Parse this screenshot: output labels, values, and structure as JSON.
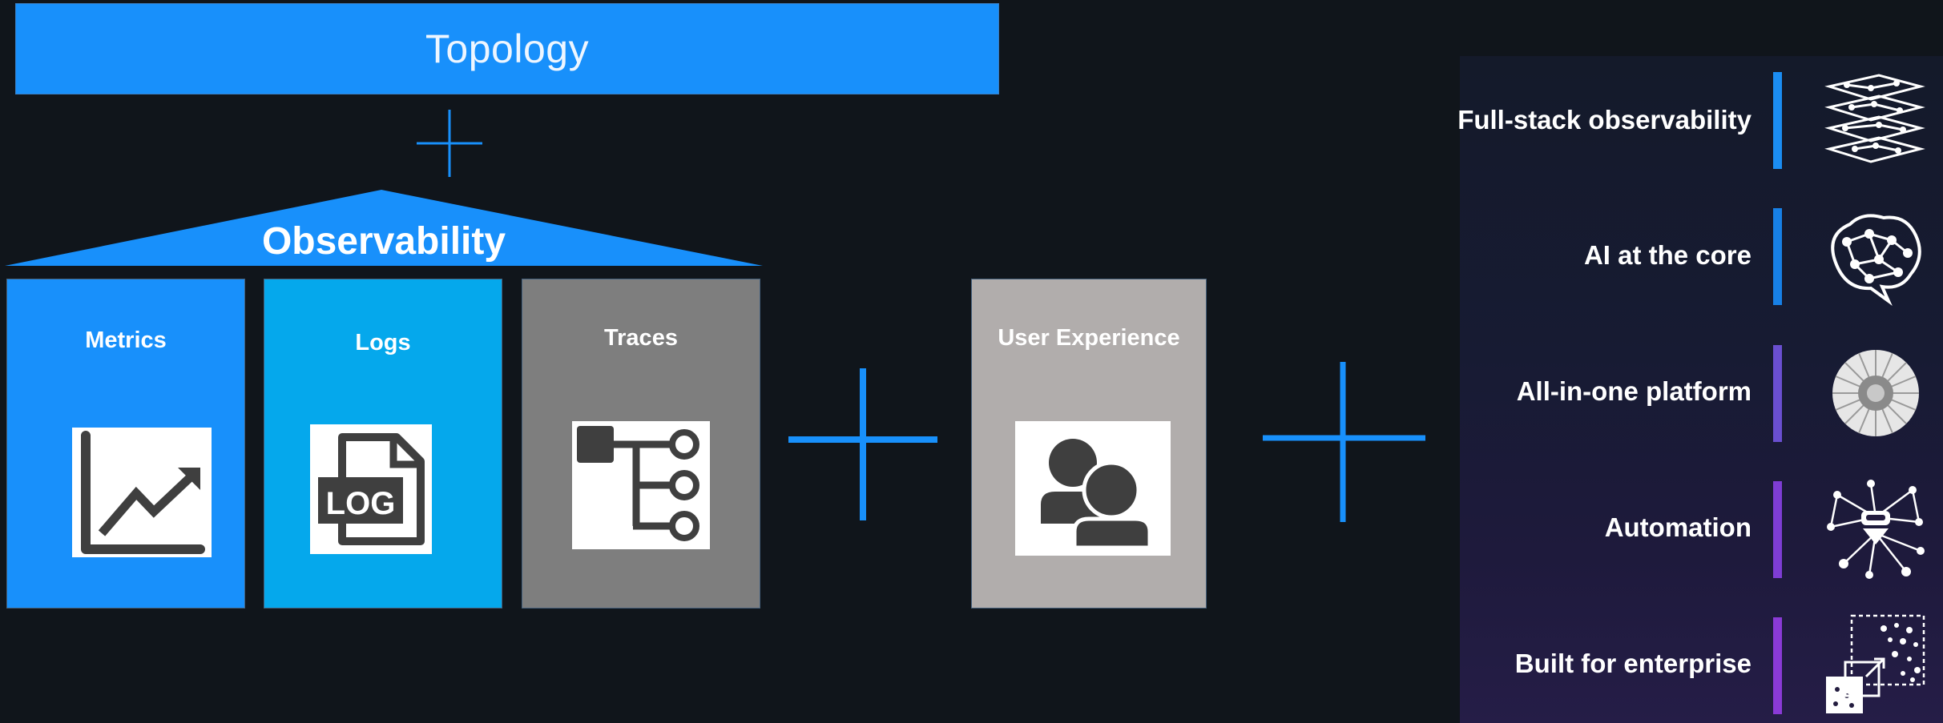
{
  "topology": {
    "label": "Topology"
  },
  "observability": {
    "title": "Observability"
  },
  "pillars": [
    {
      "label": "Metrics",
      "icon": "line-chart-icon",
      "color": "#1890fb"
    },
    {
      "label": "Logs",
      "icon": "log-file-icon",
      "icon_text": "LOG",
      "color": "#05a8ec"
    },
    {
      "label": "Traces",
      "icon": "trace-tree-icon",
      "color": "#7e7e7e"
    }
  ],
  "user_experience": {
    "label": "User Experience",
    "icon": "users-icon",
    "color": "#b1adac"
  },
  "features": [
    {
      "label": "Full-stack observability",
      "icon": "layers-network-icon",
      "bar_color": "#1b8df2"
    },
    {
      "label": "AI at the core",
      "icon": "brain-icon",
      "bar_color": "#1780e6"
    },
    {
      "label": "All-in-one platform",
      "icon": "platform-disc-icon",
      "bar_color": "#6a4fd0"
    },
    {
      "label": "Automation",
      "icon": "automation-network-icon",
      "bar_color": "#7e3dd4"
    },
    {
      "label": "Built for enterprise",
      "icon": "enterprise-scale-icon",
      "bar_color": "#8a3ad6"
    }
  ],
  "colors": {
    "accent": "#1890fb",
    "background": "#10151b"
  }
}
